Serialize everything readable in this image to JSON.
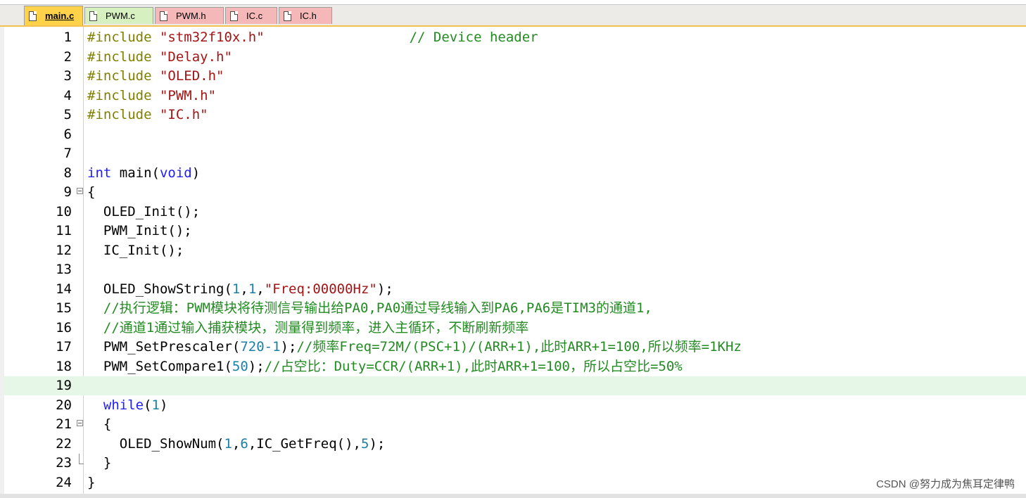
{
  "tabs": [
    {
      "label": "main.c",
      "active": true,
      "color": "#ffd24a"
    },
    {
      "label": "PWM.c",
      "active": false,
      "color": "#d7f0c0"
    },
    {
      "label": "PWM.h",
      "active": false,
      "color": "#f4b8b8"
    },
    {
      "label": "IC.c",
      "active": false,
      "color": "#f4b8b8"
    },
    {
      "label": "IC.h",
      "active": false,
      "color": "#f4b8b8"
    }
  ],
  "editor": {
    "current_line": 19,
    "lines": [
      {
        "n": "1",
        "segs": [
          [
            "pp",
            "#include "
          ],
          [
            "str",
            "\"stm32f10x.h\""
          ],
          [
            "",
            "                  "
          ],
          [
            "cmt",
            "// Device header"
          ]
        ]
      },
      {
        "n": "2",
        "segs": [
          [
            "pp",
            "#include "
          ],
          [
            "str",
            "\"Delay.h\""
          ]
        ]
      },
      {
        "n": "3",
        "segs": [
          [
            "pp",
            "#include "
          ],
          [
            "str",
            "\"OLED.h\""
          ]
        ]
      },
      {
        "n": "4",
        "segs": [
          [
            "pp",
            "#include "
          ],
          [
            "str",
            "\"PWM.h\""
          ]
        ]
      },
      {
        "n": "5",
        "segs": [
          [
            "pp",
            "#include "
          ],
          [
            "str",
            "\"IC.h\""
          ]
        ]
      },
      {
        "n": "6",
        "segs": []
      },
      {
        "n": "7",
        "segs": []
      },
      {
        "n": "8",
        "segs": [
          [
            "kw",
            "int"
          ],
          [
            "",
            " main("
          ],
          [
            "kw",
            "void"
          ],
          [
            "",
            ")"
          ]
        ]
      },
      {
        "n": "9",
        "fold": "open",
        "segs": [
          [
            "",
            "{"
          ]
        ]
      },
      {
        "n": "10",
        "segs": [
          [
            "",
            "  OLED_Init();"
          ]
        ]
      },
      {
        "n": "11",
        "segs": [
          [
            "",
            "  PWM_Init();"
          ]
        ]
      },
      {
        "n": "12",
        "segs": [
          [
            "",
            "  IC_Init();"
          ]
        ]
      },
      {
        "n": "13",
        "segs": []
      },
      {
        "n": "14",
        "segs": [
          [
            "",
            "  OLED_ShowString("
          ],
          [
            "num",
            "1"
          ],
          [
            "",
            ","
          ],
          [
            "num",
            "1"
          ],
          [
            "",
            ","
          ],
          [
            "str",
            "\"Freq:00000Hz\""
          ],
          [
            "",
            ");"
          ]
        ]
      },
      {
        "n": "15",
        "segs": [
          [
            "cmt",
            "  //执行逻辑：PWM模块将待测信号输出给PA0,PA0通过导线输入到PA6,PA6是TIM3的通道1,"
          ]
        ]
      },
      {
        "n": "16",
        "segs": [
          [
            "cmt",
            "  //通道1通过输入捕获模块，测量得到频率，进入主循环，不断刷新频率"
          ]
        ]
      },
      {
        "n": "17",
        "segs": [
          [
            "",
            "  PWM_SetPrescaler("
          ],
          [
            "num",
            "720-1"
          ],
          [
            "",
            ");"
          ],
          [
            "cmt",
            "//频率Freq=72M/(PSC+1)/(ARR+1),此时ARR+1=100,所以频率=1KHz"
          ]
        ]
      },
      {
        "n": "18",
        "segs": [
          [
            "",
            "  PWM_SetCompare1("
          ],
          [
            "num",
            "50"
          ],
          [
            "",
            ");"
          ],
          [
            "cmt",
            "//占空比：Duty=CCR/(ARR+1),此时ARR+1=100，所以占空比=50%"
          ]
        ]
      },
      {
        "n": "19",
        "segs": []
      },
      {
        "n": "20",
        "segs": [
          [
            "",
            "  "
          ],
          [
            "kw",
            "while"
          ],
          [
            "",
            "("
          ],
          [
            "num",
            "1"
          ],
          [
            "",
            ")"
          ]
        ]
      },
      {
        "n": "21",
        "fold": "open",
        "segs": [
          [
            "",
            "  {"
          ]
        ]
      },
      {
        "n": "22",
        "segs": [
          [
            "",
            "    OLED_ShowNum("
          ],
          [
            "num",
            "1"
          ],
          [
            "",
            ","
          ],
          [
            "num",
            "6"
          ],
          [
            "",
            ",IC_GetFreq(),"
          ],
          [
            "num",
            "5"
          ],
          [
            "",
            ");"
          ]
        ]
      },
      {
        "n": "23",
        "fold": "end",
        "segs": [
          [
            "",
            "  }"
          ]
        ]
      },
      {
        "n": "24",
        "segs": [
          [
            "",
            "}"
          ]
        ]
      }
    ]
  },
  "watermark": "CSDN @努力成为焦耳定律鸭"
}
